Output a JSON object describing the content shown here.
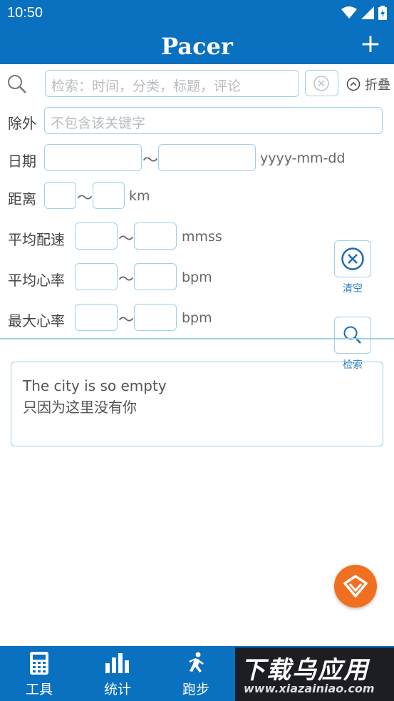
{
  "status": {
    "time": "10:50"
  },
  "appbar": {
    "title": "Pacer",
    "add_label": "+"
  },
  "search": {
    "placeholder": "检索：时间，分类，标题，评论",
    "fold_label": "折叠"
  },
  "filters": {
    "exclude": {
      "label": "除外",
      "placeholder": "不包含该关键字"
    },
    "date": {
      "label": "日期",
      "unit": "yyyy-mm-dd"
    },
    "distance": {
      "label": "距离",
      "unit": "km"
    },
    "pace": {
      "label": "平均配速",
      "unit": "mmss"
    },
    "avg_hr": {
      "label": "平均心率",
      "unit": "bpm"
    },
    "max_hr": {
      "label": "最大心率",
      "unit": "bpm"
    },
    "tilde": "〜"
  },
  "actions": {
    "clear_label": "清空",
    "search_label": "检索"
  },
  "note": {
    "line1": "The city is so empty",
    "line2": "只因为这里没有你"
  },
  "nav": [
    {
      "label": "工具",
      "icon": "calculator-icon"
    },
    {
      "label": "统计",
      "icon": "bar-chart-icon"
    },
    {
      "label": "跑步",
      "icon": "runner-icon"
    }
  ],
  "watermark": {
    "text": "下载乌应用",
    "site": "www.xiazainiao.com"
  },
  "colors": {
    "primary": "#0a70c0",
    "border": "#9fd0e6",
    "fab": "#f07020"
  }
}
